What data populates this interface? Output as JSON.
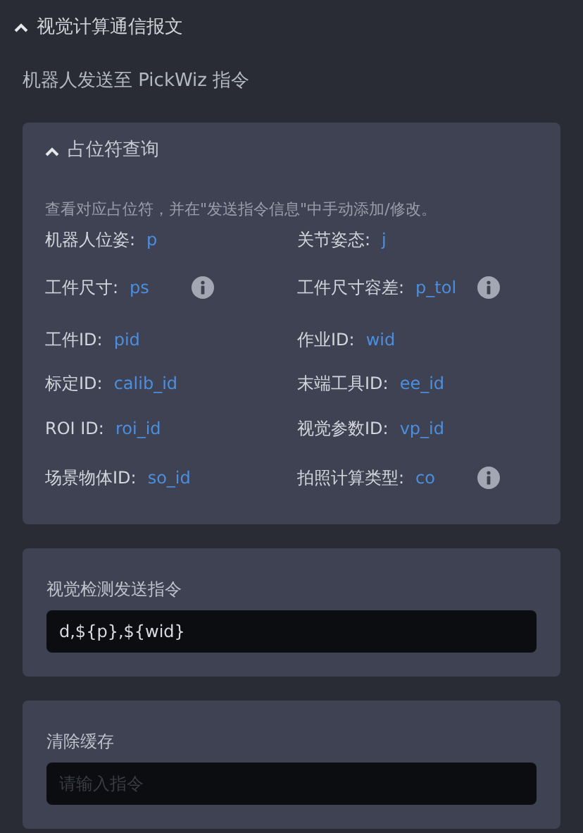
{
  "section": {
    "title": "视觉计算通信报文",
    "expanded": true
  },
  "subtitle": "机器人发送至 PickWiz 指令",
  "placeholder_panel": {
    "title": "占位符查询",
    "expanded": true,
    "hint": "查看对应占位符，并在\"发送指令信息\"中手动添加/修改。",
    "items": [
      {
        "label": "机器人位姿:",
        "value": "p",
        "info": false
      },
      {
        "label": "关节姿态:",
        "value": "j",
        "info": false
      },
      {
        "label": "工件尺寸:",
        "value": "ps",
        "info": true
      },
      {
        "label": "工件尺寸容差:",
        "value": "p_tol",
        "info": true
      },
      {
        "label": "工件ID:",
        "value": "pid",
        "info": false
      },
      {
        "label": "作业ID:",
        "value": "wid",
        "info": false
      },
      {
        "label": "标定ID:",
        "value": "calib_id",
        "info": false
      },
      {
        "label": "末端工具ID:",
        "value": "ee_id",
        "info": false
      },
      {
        "label": "ROI ID:",
        "value": "roi_id",
        "info": false
      },
      {
        "label": "视觉参数ID:",
        "value": "vp_id",
        "info": false
      },
      {
        "label": "场景物体ID:",
        "value": "so_id",
        "info": false
      },
      {
        "label": "拍照计算类型:",
        "value": "co",
        "info": true
      }
    ]
  },
  "fields": [
    {
      "label": "视觉检测发送指令",
      "value": "d,${p},${wid}"
    },
    {
      "label": "清除缓存",
      "placeholder": "请输入指令"
    }
  ]
}
